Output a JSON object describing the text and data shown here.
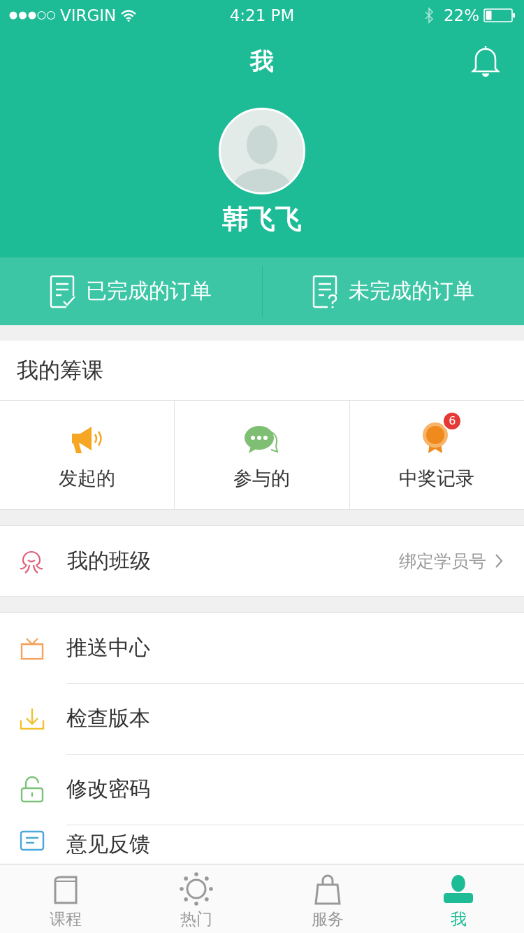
{
  "status_bar": {
    "carrier": "VIRGIN",
    "time": "4:21 PM",
    "battery": "22%"
  },
  "header": {
    "title": "我",
    "user_name": "韩飞飞"
  },
  "orders": [
    {
      "kind": "done",
      "label": "已完成的订单"
    },
    {
      "kind": "pending",
      "label": "未完成的订单"
    }
  ],
  "crowdfunding": {
    "title": "我的筹课",
    "items": [
      {
        "kind": "megaphone",
        "label": "发起的"
      },
      {
        "kind": "chat",
        "label": "参与的"
      },
      {
        "kind": "medal",
        "label": "中奖记录",
        "badge": "6"
      }
    ]
  },
  "class_row": {
    "label": "我的班级",
    "action": "绑定学员号"
  },
  "menu": [
    {
      "kind": "gift",
      "label": "推送中心"
    },
    {
      "kind": "download",
      "label": "检查版本"
    },
    {
      "kind": "lock",
      "label": "修改密码"
    },
    {
      "kind": "note",
      "label": "意见反馈"
    }
  ],
  "tabs": [
    {
      "kind": "book",
      "label": "课程",
      "selected": false
    },
    {
      "kind": "sun",
      "label": "热门",
      "selected": false
    },
    {
      "kind": "bag",
      "label": "服务",
      "selected": false
    },
    {
      "kind": "person",
      "label": "我",
      "selected": true
    }
  ]
}
